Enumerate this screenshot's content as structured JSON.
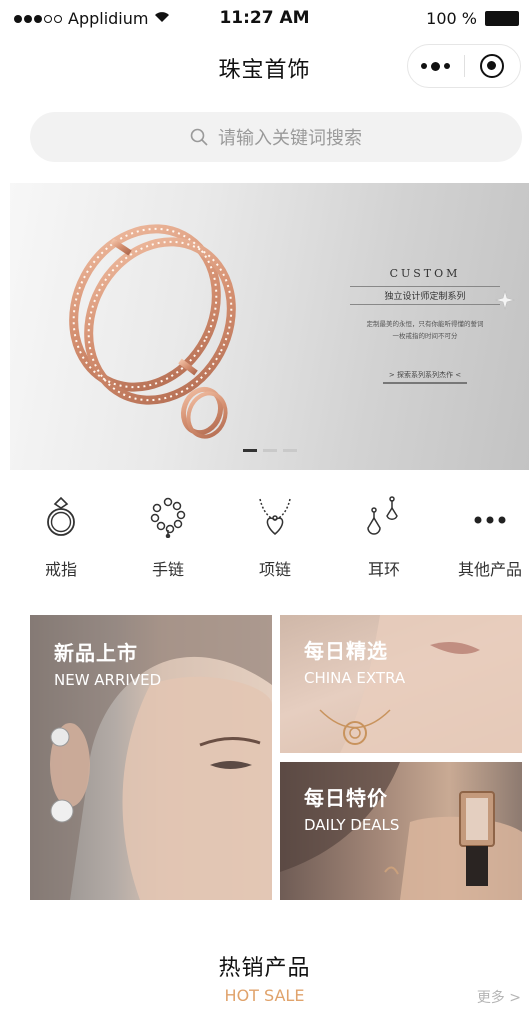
{
  "status": {
    "carrier": "Applidium",
    "time": "11:27 AM",
    "battery": "100 %"
  },
  "nav": {
    "title": "珠宝首饰"
  },
  "search": {
    "placeholder": "请输入关键词搜索"
  },
  "banner": {
    "headline": "CUSTOM",
    "subline": "独立设计师定制系列",
    "description_line1": "定制最美的永恒，只有你能听得懂的誓词",
    "description_line2": "一枚戒指的时间不可分",
    "link_text": "> 探索系列系列杰作 <",
    "slides_total": 3,
    "active_slide": 1
  },
  "categories": [
    {
      "label": "戒指",
      "icon": "ring-icon"
    },
    {
      "label": "手链",
      "icon": "bracelet-icon"
    },
    {
      "label": "项链",
      "icon": "necklace-icon"
    },
    {
      "label": "耳环",
      "icon": "earring-icon"
    },
    {
      "label": "其他产品",
      "icon": "more-icon"
    }
  ],
  "promos": [
    {
      "title": "新品上市",
      "subtitle": "NEW ARRIVED"
    },
    {
      "title": "每日精选",
      "subtitle": "CHINA EXTRA"
    },
    {
      "title": "每日特价",
      "subtitle": "DAILY DEALS"
    }
  ],
  "hot_sale": {
    "title": "热销产品",
    "subtitle": "HOT SALE",
    "more": "更多 >"
  },
  "colors": {
    "accent": "#e0a36c",
    "rose_gold": "#d99a7e",
    "search_bg": "#f2f2f2"
  }
}
